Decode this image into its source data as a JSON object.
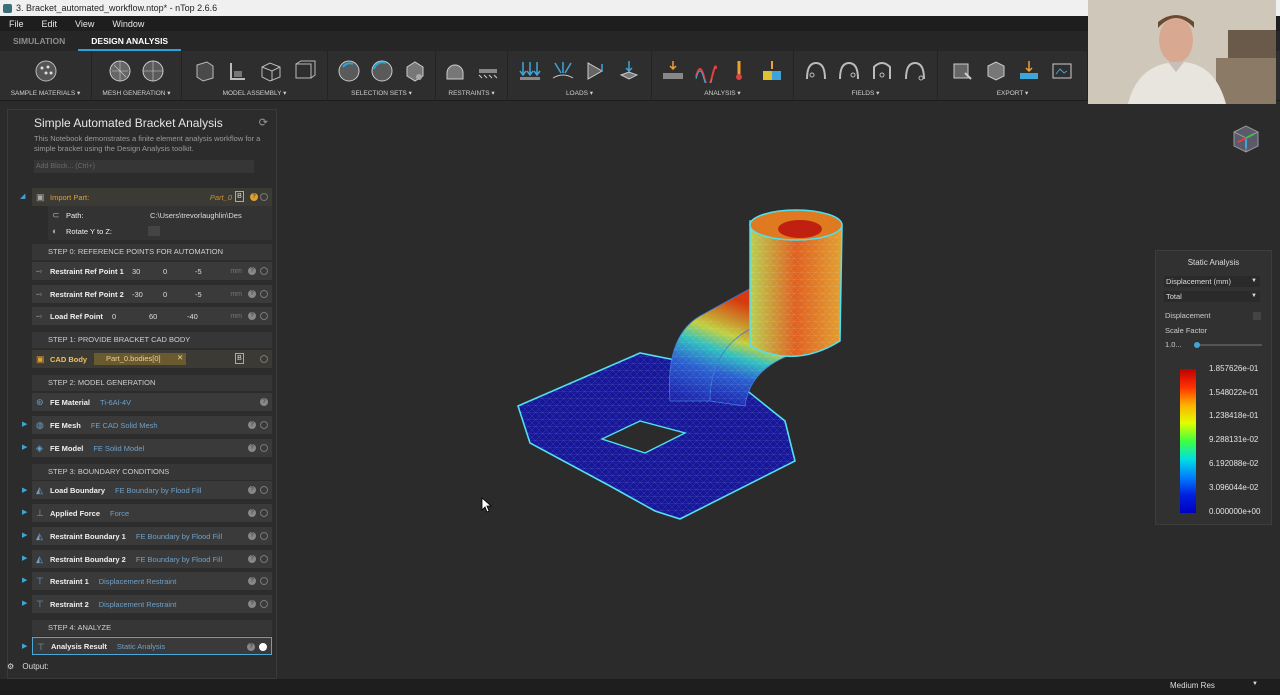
{
  "window": {
    "title": "3. Bracket_automated_workflow.ntop* - nTop 2.6.6"
  },
  "menu": [
    "File",
    "Edit",
    "View",
    "Window"
  ],
  "ribbon_tabs": [
    {
      "label": "SIMULATION",
      "active": false
    },
    {
      "label": "DESIGN ANALYSIS",
      "active": true
    }
  ],
  "ribbon_groups": [
    {
      "label": "SAMPLE MATERIALS ▾"
    },
    {
      "label": "MESH GENERATION ▾"
    },
    {
      "label": "MODEL ASSEMBLY ▾"
    },
    {
      "label": "SELECTION SETS ▾"
    },
    {
      "label": "RESTRAINTS ▾"
    },
    {
      "label": "LOADS ▾"
    },
    {
      "label": "ANALYSIS ▾"
    },
    {
      "label": "FIELDS ▾"
    },
    {
      "label": "EXPORT ▾"
    }
  ],
  "notebook": {
    "title": "Simple Automated Bracket Analysis",
    "description": "This Notebook demonstrates a finite element analysis workflow for a simple bracket using the Design Analysis toolkit.",
    "add_block": "Add Block... (Ctrl+)",
    "import": {
      "label": "Import Part:",
      "var": "Part_0",
      "path_label": "Path:",
      "path": "C:\\Users\\trevorlaughlin\\Des",
      "rotate_label": "Rotate Y to Z:"
    },
    "step0": "STEP 0: REFERENCE POINTS FOR AUTOMATION",
    "points": [
      {
        "label": "Restraint Ref Point 1",
        "x": "30",
        "y": "0",
        "z": "-5",
        "unit": "mm"
      },
      {
        "label": "Restraint Ref Point 2",
        "x": "-30",
        "y": "0",
        "z": "-5",
        "unit": "mm"
      },
      {
        "label": "Load Ref Point",
        "x": "0",
        "y": "60",
        "z": "-40",
        "unit": "mm"
      }
    ],
    "step1": "STEP 1: PROVIDE BRACKET CAD BODY",
    "cad": {
      "label": "CAD Body",
      "value": "Part_0.bodies[0]"
    },
    "step2": "STEP 2: MODEL GENERATION",
    "material": {
      "label": "FE Material",
      "value": "Ti-6Al-4V"
    },
    "mesh": {
      "label": "FE Mesh",
      "value": "FE CAD Solid Mesh"
    },
    "model": {
      "label": "FE Model",
      "value": "FE Solid Model"
    },
    "step3": "STEP 3: BOUNDARY CONDITIONS",
    "bcs": [
      {
        "label": "Load Boundary",
        "value": "FE Boundary by Flood Fill"
      },
      {
        "label": "Applied Force",
        "value": "Force"
      },
      {
        "label": "Restraint Boundary 1",
        "value": "FE Boundary by Flood Fill"
      },
      {
        "label": "Restraint Boundary 2",
        "value": "FE Boundary by Flood Fill"
      },
      {
        "label": "Restraint 1",
        "value": "Displacement Restraint"
      },
      {
        "label": "Restraint 2",
        "value": "Displacement Restraint"
      }
    ],
    "step4": "STEP 4: ANALYZE",
    "result": {
      "label": "Analysis Result",
      "value": "Static Analysis"
    }
  },
  "output_label": "Output:",
  "legend": {
    "title": "Static Analysis",
    "quantity": "Displacement (mm)",
    "component": "Total",
    "displacement_label": "Displacement",
    "scale_label": "Scale Factor",
    "scale_value": "1.0...",
    "ticks": [
      "1.857626e-01",
      "1.548022e-01",
      "1.238418e-01",
      "9.288131e-02",
      "6.192088e-02",
      "3.096044e-02",
      "0.000000e+00"
    ],
    "colors": {
      "max": "#c00000",
      "mid": "#00ff66",
      "min": "#0000cc"
    }
  },
  "status": {
    "resolution": "Medium Res"
  }
}
